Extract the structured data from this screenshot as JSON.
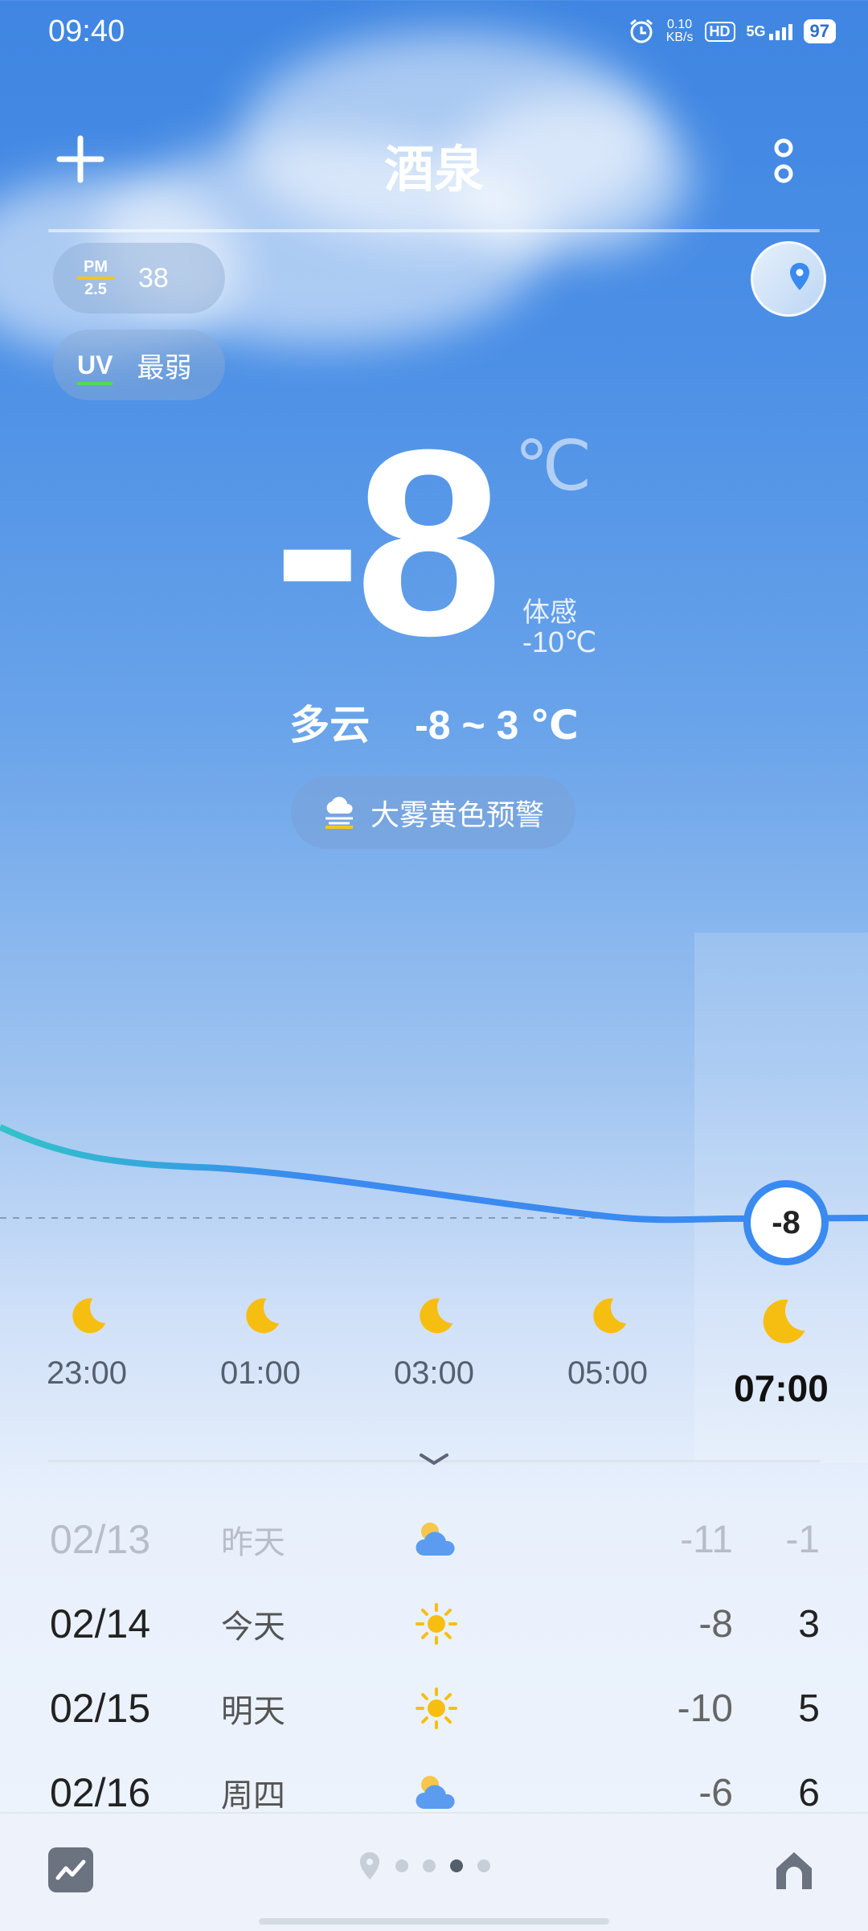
{
  "status_bar": {
    "time": "09:40",
    "net_speed_value": "0.10",
    "net_speed_unit": "KB/s",
    "hd": "HD",
    "network": "5G",
    "battery": "97"
  },
  "header": {
    "city": "酒泉"
  },
  "air": {
    "pm_top": "PM",
    "pm_bottom": "2.5",
    "pm_value": "38",
    "uv_label": "UV",
    "uv_value": "最弱"
  },
  "current": {
    "temp": "-8",
    "unit": "℃",
    "feels_label": "体感",
    "feels_value": "-10℃",
    "condition": "多云",
    "range": "-8 ~ 3 ℃"
  },
  "alert": {
    "text": "大雾黄色预警"
  },
  "hourly": {
    "active_temp": "-8",
    "hours": [
      {
        "time": "23:00",
        "icon": "moon-icon"
      },
      {
        "time": "01:00",
        "icon": "moon-icon"
      },
      {
        "time": "03:00",
        "icon": "moon-icon"
      },
      {
        "time": "05:00",
        "icon": "moon-icon"
      },
      {
        "time": "07:00",
        "icon": "moon-icon",
        "active": true
      }
    ]
  },
  "daily": [
    {
      "date": "02/13",
      "label": "昨天",
      "icon": "cloudy-icon",
      "low": "-11",
      "high": "-1",
      "past": true
    },
    {
      "date": "02/14",
      "label": "今天",
      "icon": "sun-icon",
      "low": "-8",
      "high": "3"
    },
    {
      "date": "02/15",
      "label": "明天",
      "icon": "sun-icon",
      "low": "-10",
      "high": "5"
    },
    {
      "date": "02/16",
      "label": "周四",
      "icon": "cloudy-icon",
      "low": "-6",
      "high": "6"
    }
  ],
  "pager": {
    "count": 4,
    "active_index": 2
  },
  "colors": {
    "accent": "#3a8af0",
    "sun": "#f5c51a",
    "uv_bar": "#53d85b"
  }
}
